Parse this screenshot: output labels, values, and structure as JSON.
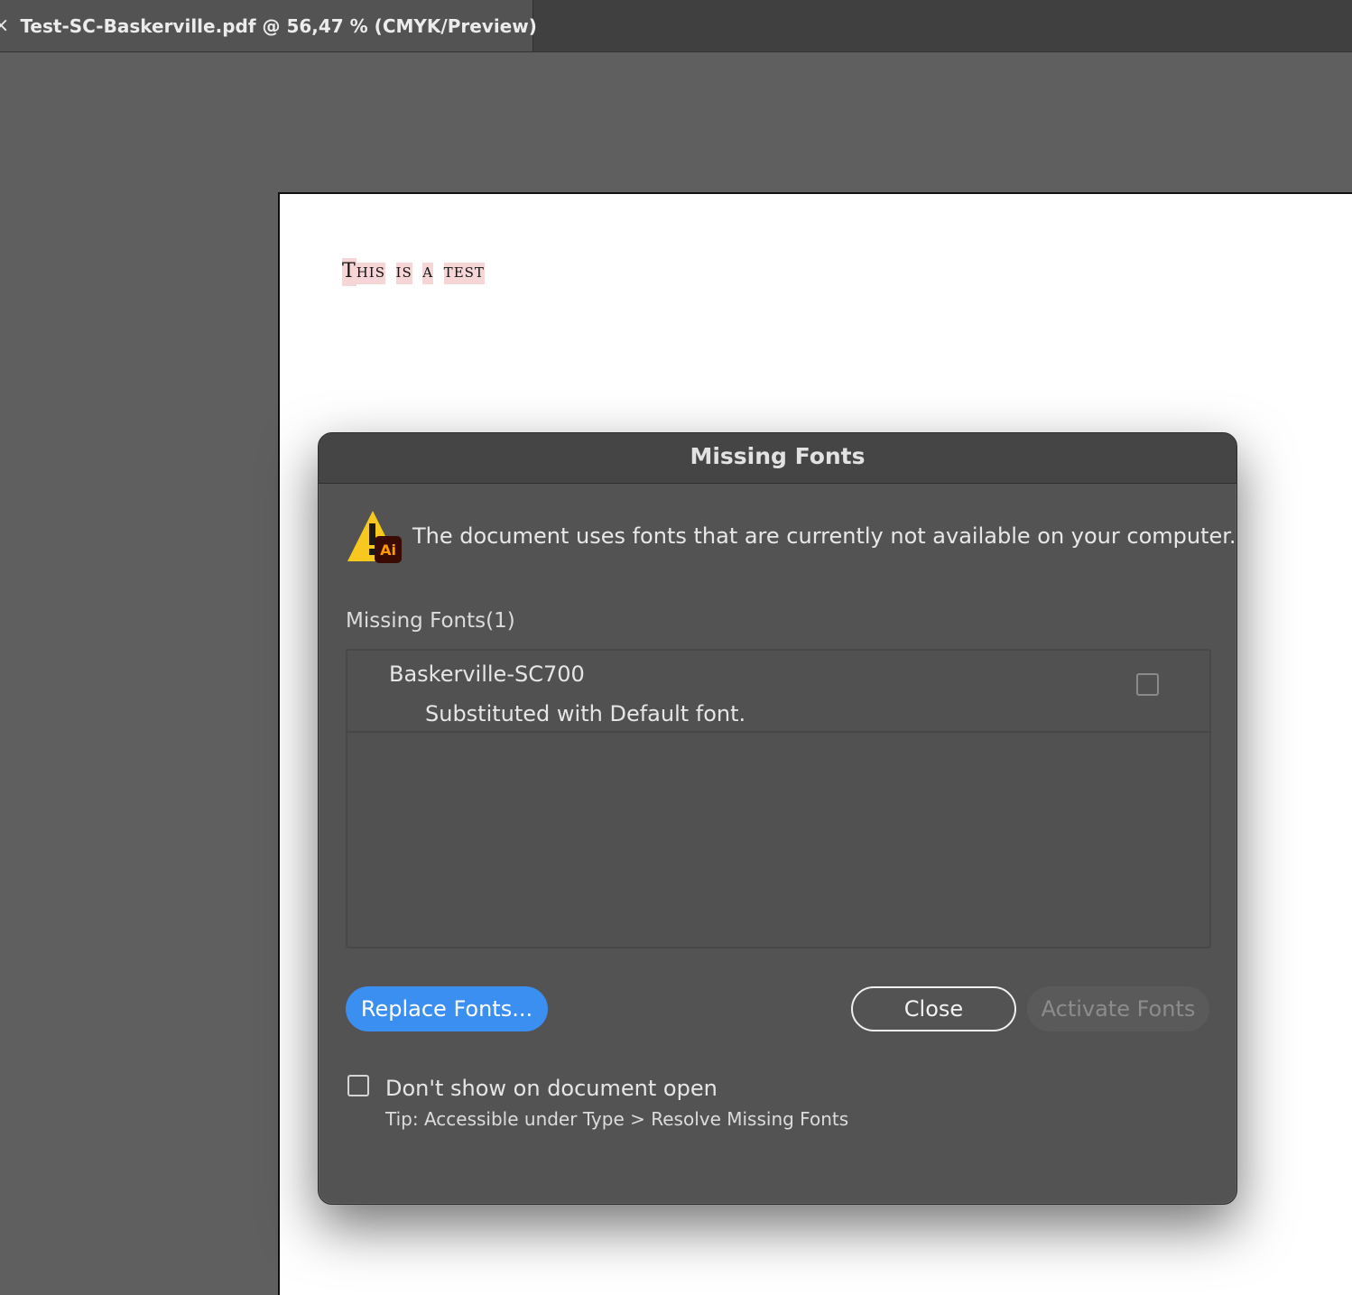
{
  "tab": {
    "close_glyph": "×",
    "title": "Test-SC-Baskerville.pdf @ 56,47 % (CMYK/Preview)"
  },
  "document": {
    "text_parts": [
      "T",
      "HIS",
      "IS",
      "A",
      "T",
      "EST"
    ]
  },
  "dialog": {
    "title": "Missing Fonts",
    "icon": "warning-triangle-with-ai-badge",
    "icon_badge": "Ai",
    "message": "The document uses fonts that are currently not available on your computer.",
    "section_label": "Missing Fonts(1)",
    "fonts": [
      {
        "name": "Baskerville-SC700",
        "status": "Substituted with Default font.",
        "checked": false
      }
    ],
    "buttons": {
      "replace": "Replace Fonts...",
      "close": "Close",
      "activate": "Activate Fonts"
    },
    "dont_show_label": "Don't show on document open",
    "dont_show_checked": false,
    "tip": "Tip: Accessible under Type > Resolve Missing Fonts"
  },
  "colors": {
    "accent": "#3b8ff0",
    "warning": "#f7c81e",
    "ai_badge": "#3a0b03",
    "ai_badge_text": "#ff9a00"
  }
}
